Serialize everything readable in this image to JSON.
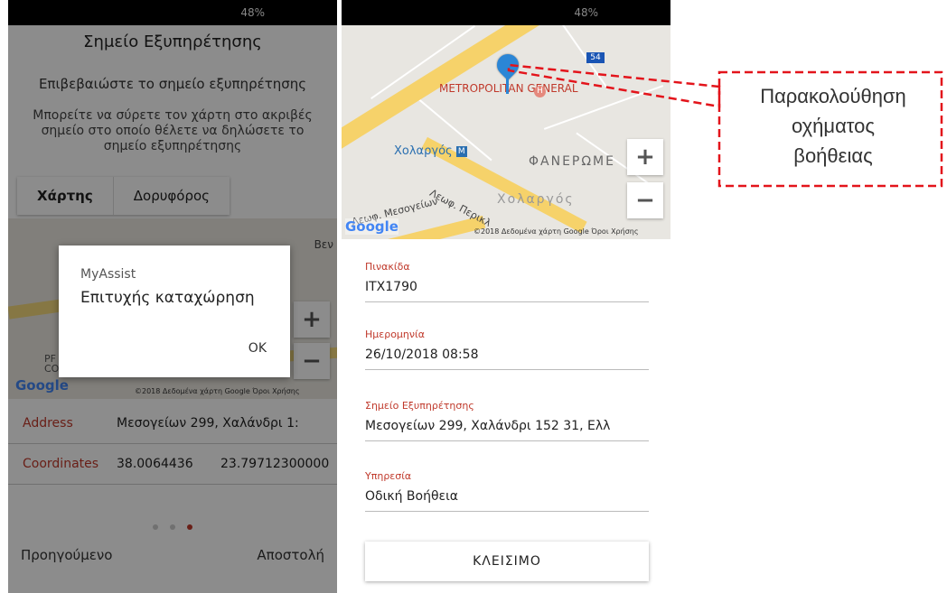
{
  "left_screen": {
    "status_battery": "48%",
    "title": "Σημείο Εξυπηρέτησης",
    "subtitle": "Επιβεβαιώστε το σημείο εξυπηρέτησης",
    "description": "Μπορείτε να σύρετε τον χάρτη στο ακριβές σημείο στο οποίο θέλετε να δηλώσετε το σημείο εξυπηρέτησης",
    "map_tabs": [
      "Χάρτης",
      "Δορυφόρος"
    ],
    "map_place_label": "Βεν",
    "map_partial_label": "PF CO",
    "zoom_in": "+",
    "zoom_out": "−",
    "google_logo": "Google",
    "attribution": "©2018 Δεδομένα χάρτη Google   Όροι Χρήσης",
    "rows": [
      {
        "label": "Address",
        "value1": "Μεσογείων 299, Χαλάνδρι 1:",
        "value2": ""
      },
      {
        "label": "Coordinates",
        "value1": "38.0064436",
        "value2": "23.79712300000"
      }
    ],
    "footer_prev": "Προηγούμενο",
    "footer_send": "Αποστολή",
    "dialog": {
      "title": "MyAssist",
      "message": "Επιτυχής καταχώρηση",
      "ok": "OK"
    }
  },
  "right_screen": {
    "status_battery": "48%",
    "map": {
      "labels": {
        "metro_general": "METROPOLITAN GENERAL",
        "xolargos_station": "Χολαργός",
        "faneromeni": "ΦΑΝΕΡΩΜΕ",
        "xolargos_area": "Χολαργός",
        "mesogeion": "Λεωφ. Μεσογείων",
        "perikleous": "Λεωφ. Περικλ",
        "route": "54",
        "hospital": "H",
        "metro_m": "M"
      },
      "zoom_in": "+",
      "zoom_out": "−",
      "google_logo": "Google",
      "attribution": "©2018 Δεδομένα χάρτη Google   Όροι Χρήσης"
    },
    "fields": [
      {
        "label": "Πινακίδα",
        "value": "ITX1790"
      },
      {
        "label": "Ημερομηνία",
        "value": "26/10/2018 08:58"
      },
      {
        "label": "Σημείο Εξυπηρέτησης",
        "value": "Μεσογείων 299, Χαλάνδρι 152 31, Ελλ"
      },
      {
        "label": "Υπηρεσία",
        "value": "Οδική Βοήθεια"
      }
    ],
    "close_button": "ΚΛΕΙΣΙΜΟ"
  },
  "callout": {
    "line1": "Παρακολούθηση",
    "line2": "οχήματος",
    "line3": "βοήθειας",
    "color": "#e3141b"
  }
}
